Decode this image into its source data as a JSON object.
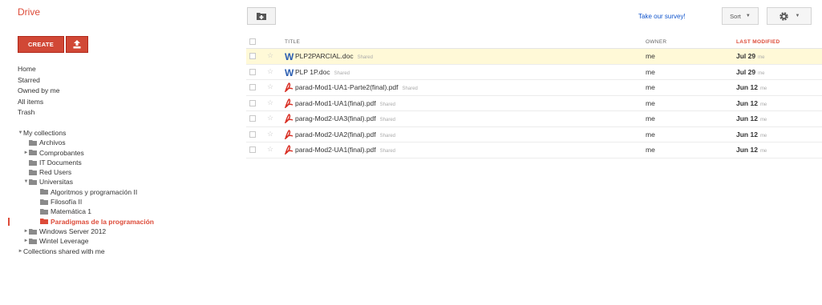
{
  "app": {
    "title": "Drive"
  },
  "sidebar": {
    "create_label": "CREATE",
    "nav": [
      "Home",
      "Starred",
      "Owned by me",
      "All items",
      "Trash"
    ],
    "my_collections": "My collections",
    "collections": [
      {
        "label": "Archivos",
        "level": 1,
        "expand": "",
        "selected": false
      },
      {
        "label": "Comprobantes",
        "level": 1,
        "expand": "collapsed",
        "selected": false
      },
      {
        "label": "IT Documents",
        "level": 1,
        "expand": "",
        "selected": false
      },
      {
        "label": "Red Users",
        "level": 1,
        "expand": "",
        "selected": false
      },
      {
        "label": "Universitas",
        "level": 1,
        "expand": "expanded",
        "selected": false
      },
      {
        "label": "Algoritmos y programación II",
        "level": 2,
        "expand": "",
        "selected": false
      },
      {
        "label": "Filosofía II",
        "level": 2,
        "expand": "",
        "selected": false
      },
      {
        "label": "Matemática 1",
        "level": 2,
        "expand": "",
        "selected": false
      },
      {
        "label": "Paradigmas de la programación",
        "level": 2,
        "expand": "",
        "selected": true
      },
      {
        "label": "Windows Server 2012",
        "level": 1,
        "expand": "collapsed",
        "selected": false
      },
      {
        "label": "Wintel Leverage",
        "level": 1,
        "expand": "collapsed",
        "selected": false
      }
    ],
    "shared_collections": "Collections shared with me"
  },
  "toolbar": {
    "survey_link": "Take our survey!",
    "sort_label": "Sort"
  },
  "table": {
    "headers": {
      "title": "TITLE",
      "owner": "OWNER",
      "modified": "LAST MODIFIED"
    },
    "rows": [
      {
        "name": "PLP2PARCIAL.doc",
        "type": "doc",
        "shared": "Shared",
        "owner": "me",
        "modified": "Jul 29",
        "by": "me",
        "highlight": true
      },
      {
        "name": "PLP 1P.doc",
        "type": "doc",
        "shared": "Shared",
        "owner": "me",
        "modified": "Jul 29",
        "by": "me",
        "highlight": false
      },
      {
        "name": "parad-Mod1-UA1-Parte2(final).pdf",
        "type": "pdf",
        "shared": "Shared",
        "owner": "me",
        "modified": "Jun 12",
        "by": "me",
        "highlight": false
      },
      {
        "name": "parad-Mod1-UA1(final).pdf",
        "type": "pdf",
        "shared": "Shared",
        "owner": "me",
        "modified": "Jun 12",
        "by": "me",
        "highlight": false
      },
      {
        "name": "parag-Mod2-UA3(final).pdf",
        "type": "pdf",
        "shared": "Shared",
        "owner": "me",
        "modified": "Jun 12",
        "by": "me",
        "highlight": false
      },
      {
        "name": "parad-Mod2-UA2(final).pdf",
        "type": "pdf",
        "shared": "Shared",
        "owner": "me",
        "modified": "Jun 12",
        "by": "me",
        "highlight": false
      },
      {
        "name": "parad-Mod2-UA1(final).pdf",
        "type": "pdf",
        "shared": "Shared",
        "owner": "me",
        "modified": "Jun 12",
        "by": "me",
        "highlight": false
      }
    ]
  },
  "colors": {
    "accent": "#dd4b39",
    "link": "#1155cc",
    "highlight": "#fff9d7"
  },
  "icons": {
    "upload": "upload-icon",
    "folder": "folder-icon",
    "gear": "gear-icon",
    "star": "star-icon",
    "doc": "word-doc-icon",
    "pdf": "pdf-icon",
    "new_folder": "new-folder-icon"
  }
}
